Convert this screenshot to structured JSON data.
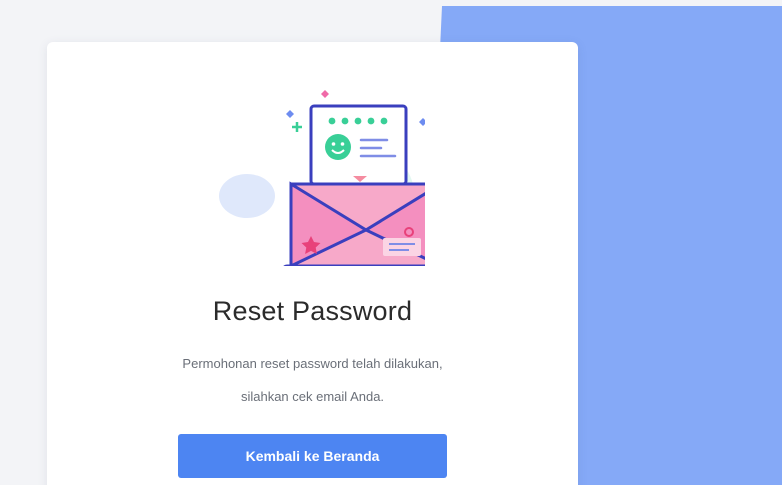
{
  "theme": {
    "accent": "#4d85f2",
    "background_blue": "#85a9f7",
    "title_color": "#2b2b2b",
    "text_color": "#6a6f78"
  },
  "card": {
    "illustration_icon": "email-reset-illustration",
    "title": "Reset Password",
    "message_line1": "Permohonan reset password telah dilakukan,",
    "message_line2": "silahkan cek email Anda.",
    "button_label": "Kembali ke Beranda"
  }
}
